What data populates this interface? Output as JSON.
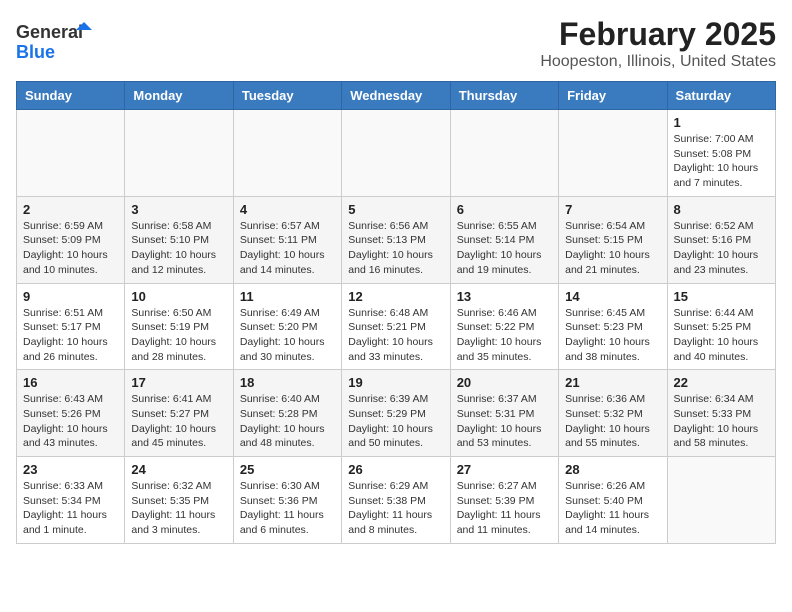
{
  "header": {
    "logo_general": "General",
    "logo_blue": "Blue",
    "title": "February 2025",
    "subtitle": "Hoopeston, Illinois, United States"
  },
  "weekdays": [
    "Sunday",
    "Monday",
    "Tuesday",
    "Wednesday",
    "Thursday",
    "Friday",
    "Saturday"
  ],
  "weeks": [
    [
      {
        "day": "",
        "info": ""
      },
      {
        "day": "",
        "info": ""
      },
      {
        "day": "",
        "info": ""
      },
      {
        "day": "",
        "info": ""
      },
      {
        "day": "",
        "info": ""
      },
      {
        "day": "",
        "info": ""
      },
      {
        "day": "1",
        "info": "Sunrise: 7:00 AM\nSunset: 5:08 PM\nDaylight: 10 hours\nand 7 minutes."
      }
    ],
    [
      {
        "day": "2",
        "info": "Sunrise: 6:59 AM\nSunset: 5:09 PM\nDaylight: 10 hours\nand 10 minutes."
      },
      {
        "day": "3",
        "info": "Sunrise: 6:58 AM\nSunset: 5:10 PM\nDaylight: 10 hours\nand 12 minutes."
      },
      {
        "day": "4",
        "info": "Sunrise: 6:57 AM\nSunset: 5:11 PM\nDaylight: 10 hours\nand 14 minutes."
      },
      {
        "day": "5",
        "info": "Sunrise: 6:56 AM\nSunset: 5:13 PM\nDaylight: 10 hours\nand 16 minutes."
      },
      {
        "day": "6",
        "info": "Sunrise: 6:55 AM\nSunset: 5:14 PM\nDaylight: 10 hours\nand 19 minutes."
      },
      {
        "day": "7",
        "info": "Sunrise: 6:54 AM\nSunset: 5:15 PM\nDaylight: 10 hours\nand 21 minutes."
      },
      {
        "day": "8",
        "info": "Sunrise: 6:52 AM\nSunset: 5:16 PM\nDaylight: 10 hours\nand 23 minutes."
      }
    ],
    [
      {
        "day": "9",
        "info": "Sunrise: 6:51 AM\nSunset: 5:17 PM\nDaylight: 10 hours\nand 26 minutes."
      },
      {
        "day": "10",
        "info": "Sunrise: 6:50 AM\nSunset: 5:19 PM\nDaylight: 10 hours\nand 28 minutes."
      },
      {
        "day": "11",
        "info": "Sunrise: 6:49 AM\nSunset: 5:20 PM\nDaylight: 10 hours\nand 30 minutes."
      },
      {
        "day": "12",
        "info": "Sunrise: 6:48 AM\nSunset: 5:21 PM\nDaylight: 10 hours\nand 33 minutes."
      },
      {
        "day": "13",
        "info": "Sunrise: 6:46 AM\nSunset: 5:22 PM\nDaylight: 10 hours\nand 35 minutes."
      },
      {
        "day": "14",
        "info": "Sunrise: 6:45 AM\nSunset: 5:23 PM\nDaylight: 10 hours\nand 38 minutes."
      },
      {
        "day": "15",
        "info": "Sunrise: 6:44 AM\nSunset: 5:25 PM\nDaylight: 10 hours\nand 40 minutes."
      }
    ],
    [
      {
        "day": "16",
        "info": "Sunrise: 6:43 AM\nSunset: 5:26 PM\nDaylight: 10 hours\nand 43 minutes."
      },
      {
        "day": "17",
        "info": "Sunrise: 6:41 AM\nSunset: 5:27 PM\nDaylight: 10 hours\nand 45 minutes."
      },
      {
        "day": "18",
        "info": "Sunrise: 6:40 AM\nSunset: 5:28 PM\nDaylight: 10 hours\nand 48 minutes."
      },
      {
        "day": "19",
        "info": "Sunrise: 6:39 AM\nSunset: 5:29 PM\nDaylight: 10 hours\nand 50 minutes."
      },
      {
        "day": "20",
        "info": "Sunrise: 6:37 AM\nSunset: 5:31 PM\nDaylight: 10 hours\nand 53 minutes."
      },
      {
        "day": "21",
        "info": "Sunrise: 6:36 AM\nSunset: 5:32 PM\nDaylight: 10 hours\nand 55 minutes."
      },
      {
        "day": "22",
        "info": "Sunrise: 6:34 AM\nSunset: 5:33 PM\nDaylight: 10 hours\nand 58 minutes."
      }
    ],
    [
      {
        "day": "23",
        "info": "Sunrise: 6:33 AM\nSunset: 5:34 PM\nDaylight: 11 hours\nand 1 minute."
      },
      {
        "day": "24",
        "info": "Sunrise: 6:32 AM\nSunset: 5:35 PM\nDaylight: 11 hours\nand 3 minutes."
      },
      {
        "day": "25",
        "info": "Sunrise: 6:30 AM\nSunset: 5:36 PM\nDaylight: 11 hours\nand 6 minutes."
      },
      {
        "day": "26",
        "info": "Sunrise: 6:29 AM\nSunset: 5:38 PM\nDaylight: 11 hours\nand 8 minutes."
      },
      {
        "day": "27",
        "info": "Sunrise: 6:27 AM\nSunset: 5:39 PM\nDaylight: 11 hours\nand 11 minutes."
      },
      {
        "day": "28",
        "info": "Sunrise: 6:26 AM\nSunset: 5:40 PM\nDaylight: 11 hours\nand 14 minutes."
      },
      {
        "day": "",
        "info": ""
      }
    ]
  ]
}
